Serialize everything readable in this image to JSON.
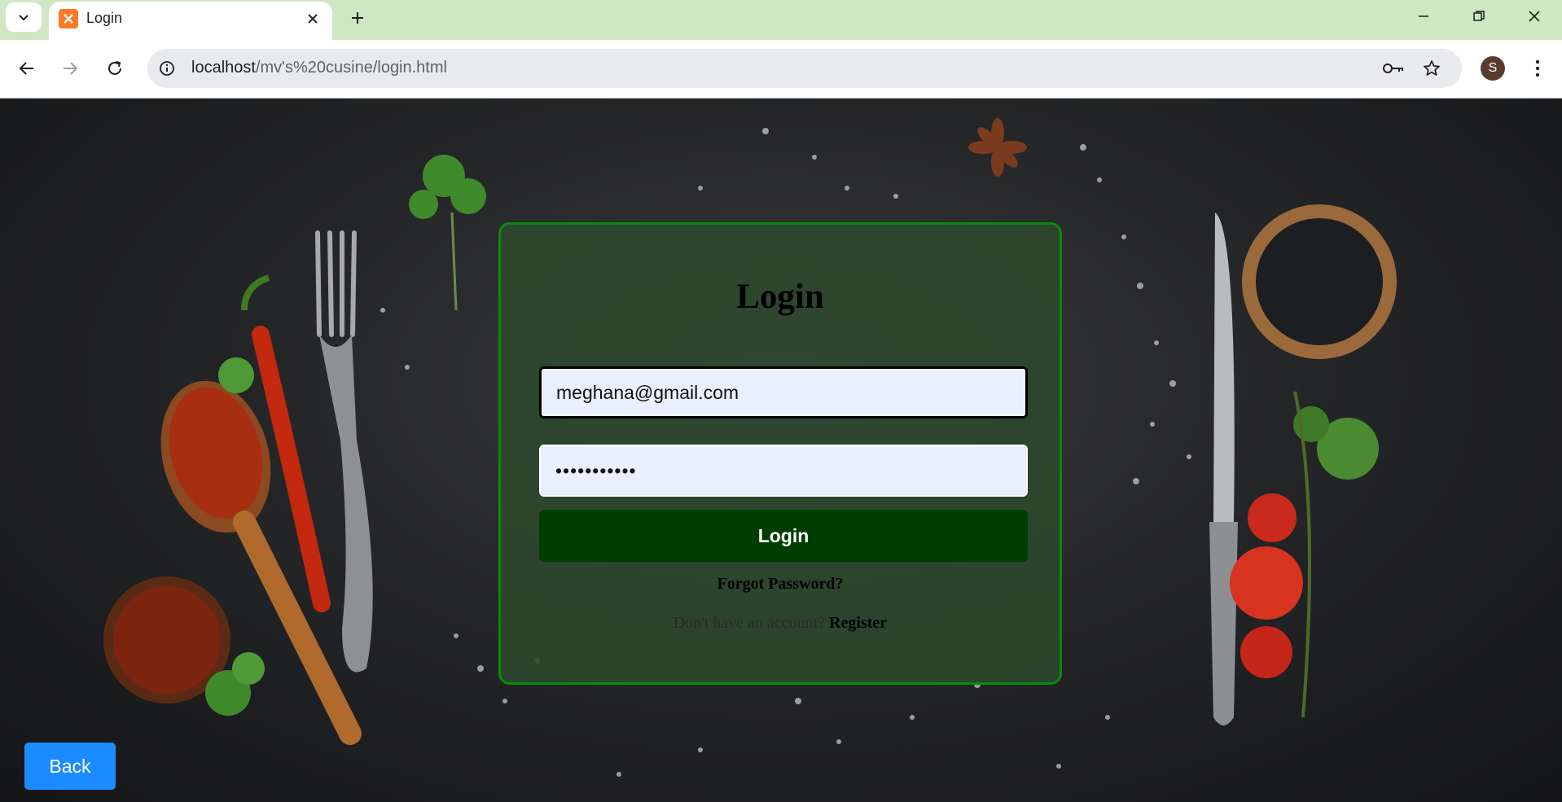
{
  "browser": {
    "tab_title": "Login",
    "url_host": "localhost",
    "url_path": "/mv's%20cusine/login.html",
    "profile_initial": "S"
  },
  "login": {
    "heading": "Login",
    "email_value": "meghana@gmail.com",
    "password_value": "•••••••••••",
    "submit_label": "Login",
    "forgot_label": "Forgot Password?",
    "no_account_text": "Don't have an account? ",
    "register_label": "Register"
  },
  "back_label": "Back",
  "colors": {
    "tabstrip": "#cfe8c3",
    "card_border": "#0a8a0a",
    "card_fill": "#2d482d",
    "login_button": "#003e00",
    "back_button": "#1a8cff",
    "input_fill": "#e8f0fe"
  }
}
